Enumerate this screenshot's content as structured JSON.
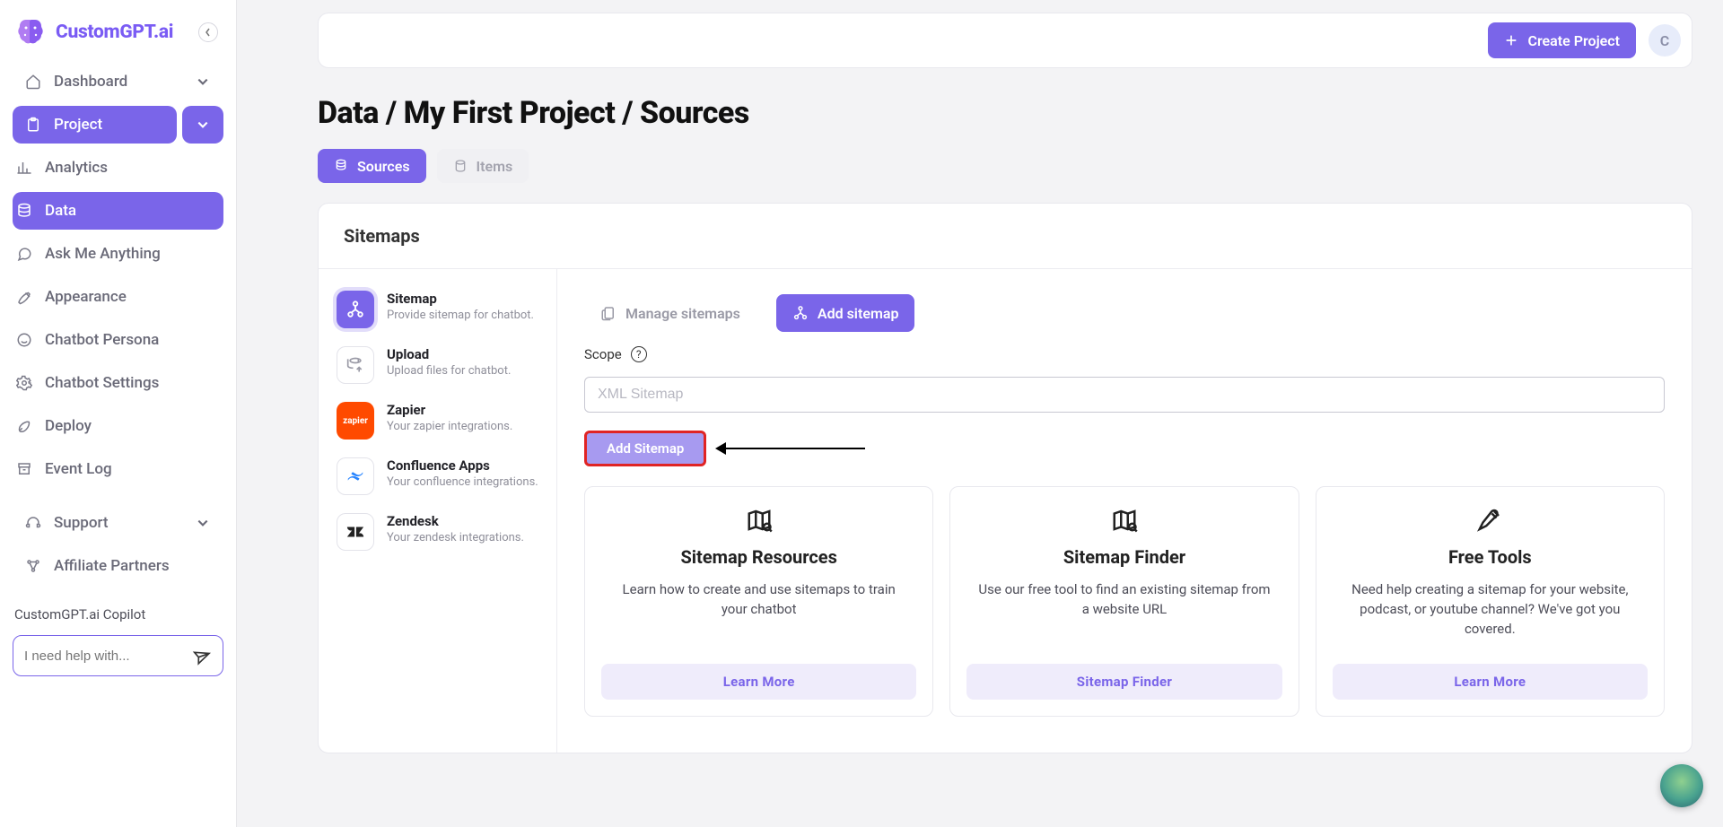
{
  "brand": {
    "name": "CustomGPT.ai"
  },
  "header": {
    "create_label": "Create Project",
    "avatar_initial": "C"
  },
  "sidebar": {
    "dashboard": "Dashboard",
    "project": "Project",
    "analytics": "Analytics",
    "data": "Data",
    "ask": "Ask Me Anything",
    "appearance": "Appearance",
    "persona": "Chatbot Persona",
    "settings": "Chatbot Settings",
    "deploy": "Deploy",
    "eventlog": "Event Log",
    "support": "Support",
    "affiliate": "Affiliate Partners",
    "copilot_label": "CustomGPT.ai Copilot",
    "copilot_placeholder": "I need help with..."
  },
  "breadcrumb": "Data / My First Project / Sources",
  "tabs": {
    "sources": "Sources",
    "items": "Items"
  },
  "panel": {
    "title": "Sitemaps",
    "sources": {
      "sitemap": {
        "title": "Sitemap",
        "desc": "Provide sitemap for chatbot."
      },
      "upload": {
        "title": "Upload",
        "desc": "Upload files for chatbot."
      },
      "zapier": {
        "title": "Zapier",
        "desc": "Your zapier integrations.",
        "badge": "zapier"
      },
      "confluence": {
        "title": "Confluence Apps",
        "desc": "Your confluence integrations."
      },
      "zendesk": {
        "title": "Zendesk",
        "desc": "Your zendesk integrations."
      }
    }
  },
  "detail": {
    "manage_label": "Manage sitemaps",
    "add_tab_label": "Add sitemap",
    "scope_label": "Scope",
    "input_placeholder": "XML Sitemap",
    "add_button": "Add Sitemap"
  },
  "cards": {
    "resources": {
      "title": "Sitemap Resources",
      "desc": "Learn how to create and use sitemaps to train your chatbot",
      "cta": "Learn More"
    },
    "finder": {
      "title": "Sitemap Finder",
      "desc": "Use our free tool to find an existing sitemap from a website URL",
      "cta": "Sitemap Finder"
    },
    "tools": {
      "title": "Free Tools",
      "desc": "Need help creating a sitemap for your website, podcast, or youtube channel? We've got you covered.",
      "cta": "Learn More"
    }
  }
}
